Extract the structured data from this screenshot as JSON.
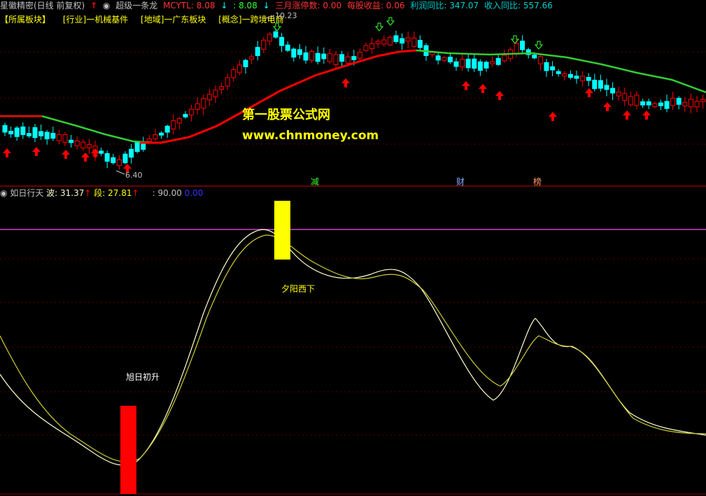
{
  "topbar": {
    "title": "星徽精密(日线 前复权)",
    "indicator_name": "超级一条龙",
    "mcytl_label": "MCYTL: 8.08",
    "mcytl_val2": ": 8.08",
    "limit_up": "三月涨停数: 0.00",
    "eps": "每股收益: 0.06",
    "profit_yoy": "利润同比: 347.07",
    "revenue_yoy": "收入同比: 557.66"
  },
  "tags": [
    "【所属板块】",
    "[行业]一机械基件",
    "[地域]一广东板块",
    "[概念]一跨境电商"
  ],
  "price": {
    "high_label": "10.23",
    "low_label": "6.40"
  },
  "watermark": {
    "line1": "第一股票公式网",
    "line2": "www.chnmoney.com"
  },
  "markers": {
    "jian": "减",
    "cai": "财",
    "bang": "榜"
  },
  "indicator": {
    "name": "如日行天",
    "bo_label": "波: 31.37",
    "duan_label": "段: 27.81",
    "level": ": 90.00",
    "zero": "0.00"
  },
  "annotations": {
    "rise": "旭日初升",
    "set": "夕阳西下"
  },
  "colors": {
    "background": "#000000",
    "up": "#ff0000",
    "down": "#00ffff",
    "ma_green": "#33cc33",
    "ma_red": "#ff0000",
    "yellow": "#ffff00",
    "purple": "#cc44cc"
  }
}
